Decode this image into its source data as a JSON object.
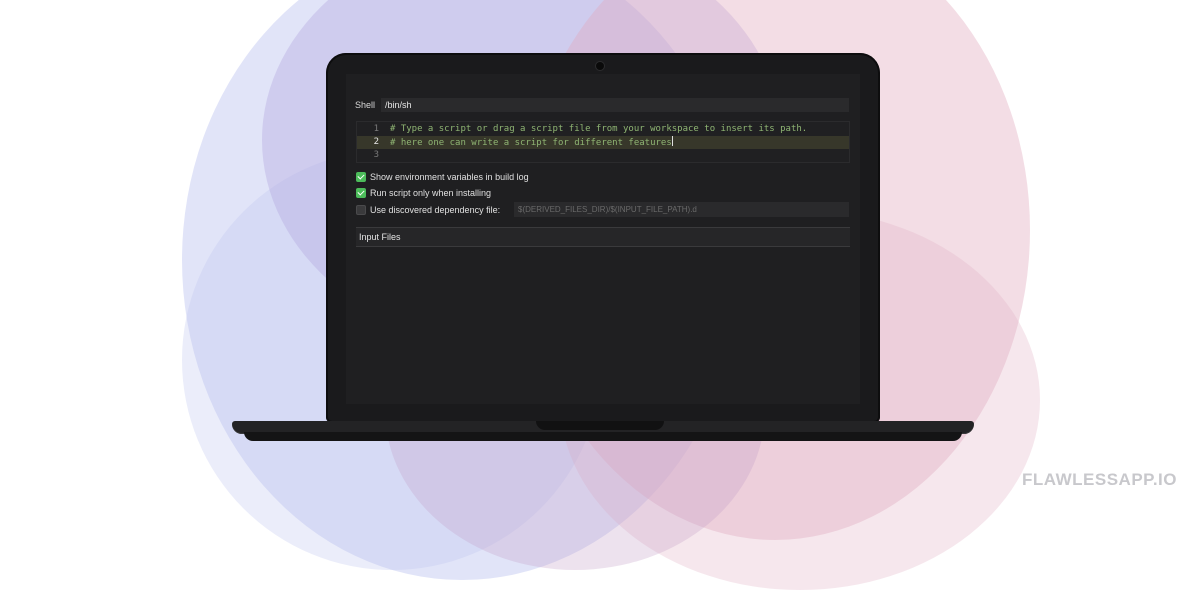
{
  "colors": {
    "accent_check": "#4cbb5a",
    "code_comment": "#8fb573",
    "bg_blue": "#c9cdf2",
    "bg_pink": "#ebc6d1"
  },
  "shell": {
    "label": "Shell",
    "value": "/bin/sh"
  },
  "editor": {
    "lines": [
      {
        "number": "1",
        "text": "# Type a script or drag a script file from your workspace to insert its path."
      },
      {
        "number": "2",
        "text": "# here one can write a script for different features"
      },
      {
        "number": "3",
        "text": ""
      }
    ]
  },
  "options": {
    "show_env": {
      "label": "Show environment variables in build log",
      "checked": true
    },
    "run_only_installing": {
      "label": "Run script only when installing",
      "checked": true
    },
    "discovered_dependency": {
      "label": "Use discovered dependency file:",
      "checked": false,
      "placeholder": "$(DERIVED_FILES_DIR)/$(INPUT_FILE_PATH).d"
    }
  },
  "input_files": {
    "label": "Input Files"
  },
  "watermark": "FLAWLESSAPP.IO"
}
